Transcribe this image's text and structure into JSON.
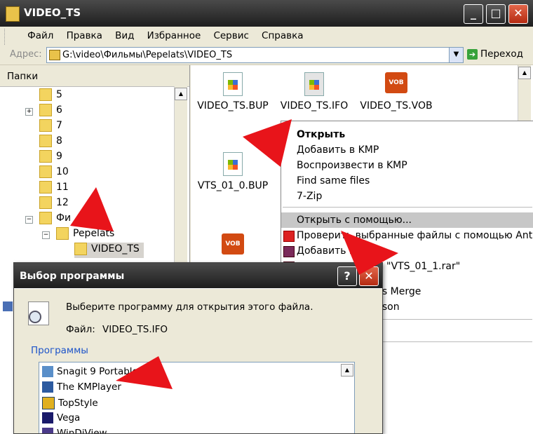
{
  "window": {
    "title": "VIDEO_TS",
    "buttons": {
      "minimize": "_",
      "maximize": "□",
      "close": "✕"
    }
  },
  "menu": [
    "Файл",
    "Правка",
    "Вид",
    "Избранное",
    "Сервис",
    "Справка"
  ],
  "address": {
    "label": "Адрес:",
    "value": "G:\\video\\Фильмы\\Pepelats\\VIDEO_TS",
    "go_label": "Переход"
  },
  "folders": {
    "header": "Папки",
    "items": [
      "5",
      "6",
      "7",
      "8",
      "9",
      "10",
      "11",
      "12",
      "Фи",
      "Pepelats",
      "VIDEO_TS"
    ]
  },
  "files": [
    {
      "name": "VIDEO_TS.BUP",
      "icon": "windows-doc-icon"
    },
    {
      "name": "VIDEO_TS.IFO",
      "icon": "windows-doc-icon"
    },
    {
      "name": "VIDEO_TS.VOB",
      "icon": "vob-icon",
      "badge": "VOB"
    },
    {
      "name": "VTS_01_0.BUP",
      "icon": "windows-doc-icon"
    },
    {
      "name": "",
      "icon": "vob-icon",
      "badge": "VOB"
    }
  ],
  "context_menu": {
    "items": [
      "Открыть",
      "Добавить в KMP",
      "Воспроизвести в KMP",
      "Find same files",
      "7-Zip",
      "Открыть с помощью...",
      "Проверить выбранные файлы с помощью AntiVir",
      "Добавить в",
      "\"VTS_01_1.rar\"",
      "is Merge",
      "ison"
    ]
  },
  "dialog": {
    "title": "Выбор программы",
    "help": "?",
    "close": "✕",
    "instruction": "Выберите программу для открытия этого файла.",
    "file_label": "Файл:",
    "file_name": "VIDEO_TS.IFO",
    "programs_header": "Программы",
    "programs": [
      "Snagit 9 Portable",
      "The KMPlayer",
      "TopStyle",
      "Vega",
      "WinDiView"
    ]
  },
  "colors": {
    "annotation_arrow": "#e8141a",
    "titlebar": "#2c2c2c",
    "link_blue": "#1d54c9",
    "close_red": "#c9371b"
  }
}
